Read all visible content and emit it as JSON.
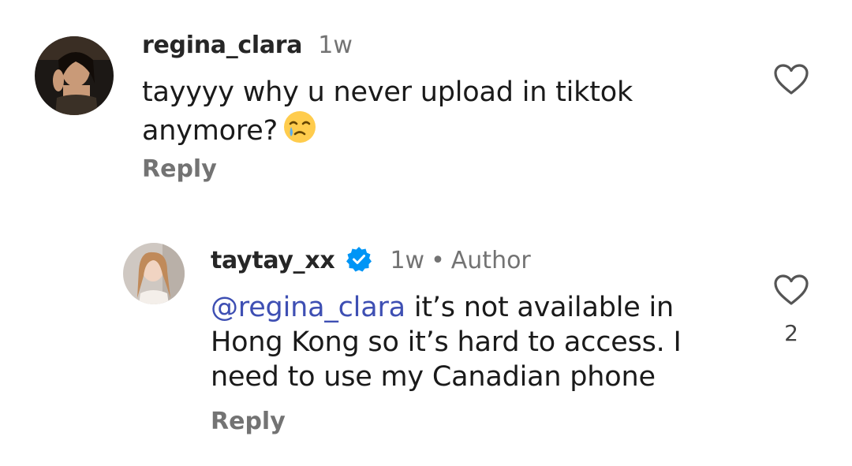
{
  "comments": [
    {
      "username": "regina_clara",
      "time": "1w",
      "text_line1": "tayyyy why u never upload in tiktok",
      "text_line2": "anymore?",
      "emoji": "face-holding-back-tears",
      "reply_label": "Reply"
    },
    {
      "username": "taytay_xx",
      "time": "1w",
      "author_label": "Author",
      "mention": "@regina_clara",
      "text_line1": " it’s not available in",
      "text_line2": "Hong Kong so it’s hard to access. I",
      "text_line3": "need to use my Canadian phone",
      "reply_label": "Reply",
      "like_count": "2",
      "verified": true
    }
  ],
  "colors": {
    "mention": "#3e4fb3",
    "verified_badge": "#0095f6",
    "secondary_text": "#737373"
  }
}
